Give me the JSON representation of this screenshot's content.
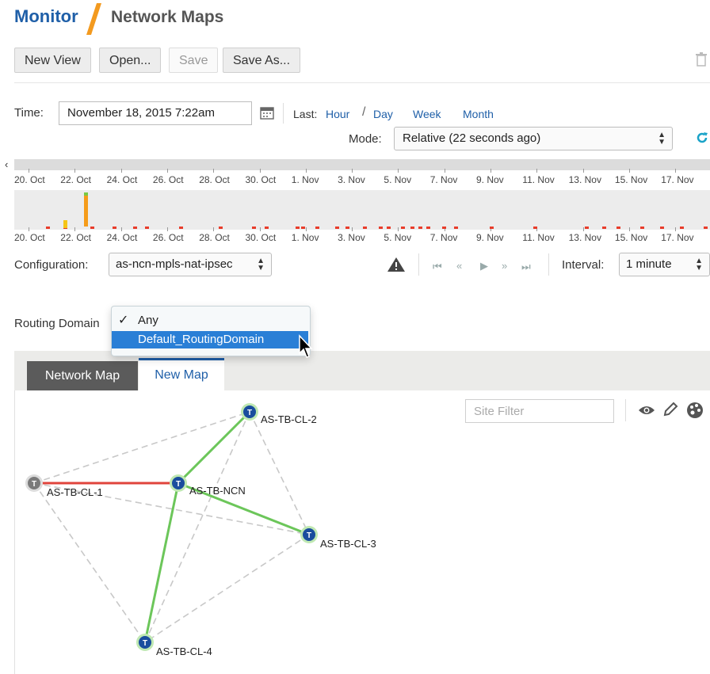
{
  "header": {
    "section": "Monitor",
    "page": "Network Maps"
  },
  "toolbar": {
    "new_view": "New View",
    "open": "Open...",
    "save": "Save",
    "save_as": "Save As..."
  },
  "time": {
    "label": "Time:",
    "value": "November 18, 2015 7:22am",
    "last_label": "Last:",
    "ranges": [
      "Hour",
      "Day",
      "Week",
      "Month"
    ],
    "mode_label": "Mode:",
    "mode_value": "Relative (22 seconds ago)"
  },
  "timeline": {
    "ticks": [
      "20. Oct",
      "22. Oct",
      "24. Oct",
      "26. Oct",
      "28. Oct",
      "30. Oct",
      "1. Nov",
      "3. Nov",
      "5. Nov",
      "7. Nov",
      "9. Nov",
      "11. Nov",
      "13. Nov",
      "15. Nov",
      "17. Nov"
    ]
  },
  "config": {
    "label": "Configuration:",
    "value": "as-ncn-mpls-nat-ipsec",
    "interval_label": "Interval:",
    "interval_value": "1 minute"
  },
  "routing": {
    "label": "Routing Domain",
    "options": [
      "Any",
      "Default_RoutingDomain"
    ],
    "checked": "Any",
    "hovered": "Default_RoutingDomain"
  },
  "tabs": {
    "network_map": "Network Map",
    "new_map": "New Map"
  },
  "filter": {
    "placeholder": "Site Filter"
  },
  "map": {
    "node_badge": "T",
    "nodes": [
      {
        "id": "AS-TB-CL-2",
        "label": "AS-TB-CL-2",
        "status": "up"
      },
      {
        "id": "AS-TB-CL-1",
        "label": "AS-TB-CL-1",
        "status": "down"
      },
      {
        "id": "AS-TB-NCN",
        "label": "AS-TB-NCN",
        "status": "up"
      },
      {
        "id": "AS-TB-CL-3",
        "label": "AS-TB-CL-3",
        "status": "up"
      },
      {
        "id": "AS-TB-CL-4",
        "label": "AS-TB-CL-4",
        "status": "up"
      }
    ],
    "links": [
      {
        "from": "AS-TB-NCN",
        "to": "AS-TB-CL-2",
        "state": "up"
      },
      {
        "from": "AS-TB-NCN",
        "to": "AS-TB-CL-3",
        "state": "up"
      },
      {
        "from": "AS-TB-NCN",
        "to": "AS-TB-CL-4",
        "state": "up"
      },
      {
        "from": "AS-TB-NCN",
        "to": "AS-TB-CL-1",
        "state": "down"
      },
      {
        "from": "AS-TB-CL-1",
        "to": "AS-TB-CL-2",
        "state": "virtual"
      },
      {
        "from": "AS-TB-CL-1",
        "to": "AS-TB-CL-3",
        "state": "virtual"
      },
      {
        "from": "AS-TB-CL-1",
        "to": "AS-TB-CL-4",
        "state": "virtual"
      },
      {
        "from": "AS-TB-CL-2",
        "to": "AS-TB-CL-3",
        "state": "virtual"
      },
      {
        "from": "AS-TB-CL-2",
        "to": "AS-TB-CL-4",
        "state": "virtual"
      },
      {
        "from": "AS-TB-CL-3",
        "to": "AS-TB-CL-4",
        "state": "virtual"
      }
    ]
  },
  "colors": {
    "accent": "#1f5fa8",
    "link_up": "#6cc65a",
    "link_down": "#e0443c",
    "link_virtual": "#c8c8c8",
    "node": "#1a4d9e",
    "node_down": "#7a7a7a"
  }
}
